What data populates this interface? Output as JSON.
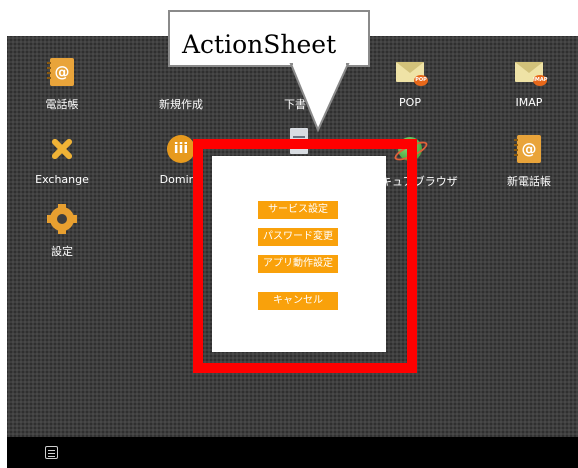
{
  "callout": {
    "text": "ActionSheet"
  },
  "apps": [
    {
      "label": "電話帳",
      "icon": "address-book-icon"
    },
    {
      "label": "新規作成",
      "icon": "new-mail-icon"
    },
    {
      "label": "下書",
      "icon": "drafts-icon"
    },
    {
      "label": "POP",
      "icon": "pop-mail-icon",
      "badge": "POP"
    },
    {
      "label": "IMAP",
      "icon": "imap-mail-icon",
      "badge": "IMAP"
    },
    {
      "label": "Exchange",
      "icon": "exchange-icon"
    },
    {
      "label": "Domino",
      "icon": "domino-icon",
      "glyph": "iii"
    },
    {
      "label": "",
      "icon": "note-icon"
    },
    {
      "label": "セキュアブラウザ",
      "icon": "secure-browser-icon"
    },
    {
      "label": "新電話帳",
      "icon": "new-address-book-icon"
    },
    {
      "label": "設定",
      "icon": "settings-gear-icon"
    }
  ],
  "action_sheet": {
    "buttons": [
      {
        "label": "サービス設定"
      },
      {
        "label": "パスワード変更"
      },
      {
        "label": "アプリ動作設定"
      }
    ],
    "cancel_label": "キャンセル"
  },
  "colors": {
    "background": "#3e3e3e",
    "taskbar": "#000000",
    "accent": "#f9a10b",
    "highlight": "#ff0000"
  },
  "taskbar": {
    "menu_icon": "menu-list-icon"
  }
}
